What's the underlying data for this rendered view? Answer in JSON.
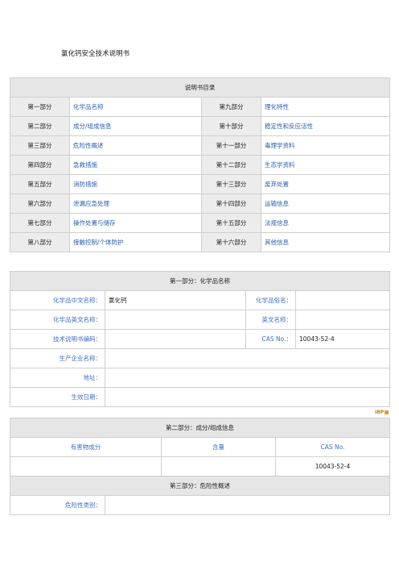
{
  "doc_title": "氯化钙安全技术说明书",
  "toc": {
    "header": "说明书目录",
    "rows": [
      {
        "p1": "第一部分",
        "n1": "化学品名称",
        "p2": "第九部分",
        "n2": "理化特性"
      },
      {
        "p1": "第二部分",
        "n1": "成分/组成信息",
        "p2": "第十部分",
        "n2": "稳定性和反应活性"
      },
      {
        "p1": "第三部分",
        "n1": "危险性概述",
        "p2": "第十一部分",
        "n2": "毒理学资料"
      },
      {
        "p1": "第四部分",
        "n1": "急救措施",
        "p2": "第十二部分",
        "n2": "生态学资料"
      },
      {
        "p1": "第五部分",
        "n1": "消防措施",
        "p2": "第十三部分",
        "n2": "废弃处置"
      },
      {
        "p1": "第六部分",
        "n1": "泄漏应急处理",
        "p2": "第十四部分",
        "n2": "运输信息"
      },
      {
        "p1": "第七部分",
        "n1": "操作处置与储存",
        "p2": "第十五部分",
        "n2": "法规信息"
      },
      {
        "p1": "第八部分",
        "n1": "接触控制/个体防护",
        "p2": "第十六部分",
        "n2": "其他信息"
      }
    ]
  },
  "part1": {
    "header": "第一部分：化学品名称",
    "cn_name_label": "化学品中文名称：",
    "cn_name_value": "氯化钙",
    "alias_label": "化学品俗名：",
    "alias_value": "",
    "en_name_label": "化学品英文名称：",
    "en_name_value": "",
    "en_label": "英文名称：",
    "en_value": "",
    "tech_label": "技术说明书编码：",
    "tech_value": "",
    "cas_label": "CAS No.：",
    "cas_value": "10043-52-4",
    "maker_label": "生产企业名称：",
    "maker_value": "",
    "address_label": "地址：",
    "address_value": "",
    "date_label": "生效日期：",
    "date_value": ""
  },
  "logo_text": "IBP",
  "part2": {
    "header": "第二部分：成分/组成信息",
    "col_component": "有害物成分",
    "col_content": "含量",
    "col_cas": "CAS No.",
    "row_component": "",
    "row_content": "",
    "row_cas": "10043-52-4"
  },
  "part3": {
    "header": "第三部分：危险性概述",
    "hazard_label": "危险性类别：",
    "hazard_value": ""
  }
}
